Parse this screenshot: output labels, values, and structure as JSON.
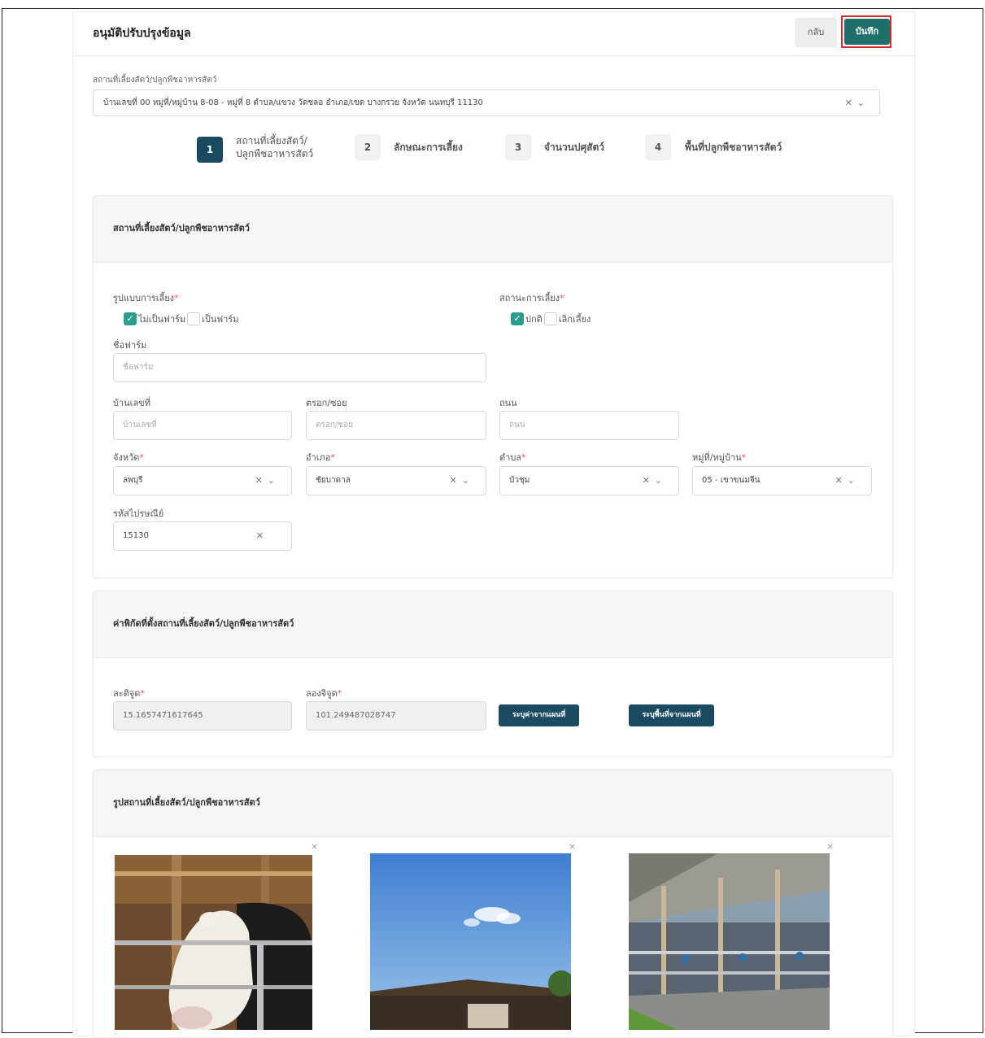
{
  "header": {
    "title": "อนุมัติปรับปรุงข้อมูล",
    "back_label": "กลับ",
    "save_label": "บันทึก"
  },
  "location_select": {
    "label": "สถานที่เลี้ยงสัตว์/ปลูกพืชอาหารสัตว์",
    "value": "บ้านเลขที่ 00 หมู่ที่/หมู่บ้าน 8-08 - หมู่ที่ 8 ตำบล/แขวง วัดชลอ อำเภอ/เขต บางกรวย จังหวัด นนทบุรี 11130"
  },
  "steps": [
    {
      "num": "1",
      "label_l1": "สถานที่เลี้ยงสัตว์/",
      "label_l2": "ปลูกพืชอาหารสัตว์",
      "active": true
    },
    {
      "num": "2",
      "label_l1": "ลักษณะการเลี้ยง",
      "label_l2": "",
      "active": false
    },
    {
      "num": "3",
      "label_l1": "จำนวนปศุสัตว์",
      "label_l2": "",
      "active": false
    },
    {
      "num": "4",
      "label_l1": "พื้นที่ปลูกพืชอาหารสัตว์",
      "label_l2": "",
      "active": false
    }
  ],
  "section1": {
    "title": "สถานที่เลี้ยงสัตว์/ปลูกพืชอาหารสัตว์",
    "farm_type": {
      "label": "รูปแบบการเลี้ยง",
      "opt1": "ไม่เป็นฟาร์ม",
      "opt1_checked": true,
      "opt2": "เป็นฟาร์ม",
      "opt2_checked": false
    },
    "status": {
      "label": "สถานะการเลี้ยง",
      "opt1": "ปกติ",
      "opt1_checked": true,
      "opt2": "เลิกเลี้ยง",
      "opt2_checked": false
    },
    "farm_name": {
      "label": "ชื่อฟาร์ม",
      "placeholder": "ชื่อฟาร์ม"
    },
    "house_no": {
      "label": "บ้านเลขที่",
      "placeholder": "บ้านเลขที่"
    },
    "soi": {
      "label": "ตรอก/ซอย",
      "placeholder": "ตรอก/ซอย"
    },
    "road": {
      "label": "ถนน",
      "placeholder": "ถนน"
    },
    "province": {
      "label": "จังหวัด",
      "value": "ลพบุรี"
    },
    "district": {
      "label": "อำเภอ",
      "value": "ชัยบาดาล"
    },
    "subdistrict": {
      "label": "ตำบล",
      "value": "บัวชุม"
    },
    "village": {
      "label": "หมู่ที่/หมู่บ้าน",
      "value": "05 - เขาขนมจีน"
    },
    "postcode": {
      "label": "รหัสไปรษณีย์",
      "value": "15130"
    }
  },
  "section2": {
    "title": "ค่าพิกัดที่ตั้งสถานที่เลี้ยงสัตว์/ปลูกพืชอาหารสัตว์",
    "lat": {
      "label": "ละติจูด",
      "value": "15.1657471617645"
    },
    "lng": {
      "label": "ลองจิจูด",
      "value": "101.249487028747"
    },
    "btn_pick_point": "ระบุค่าจากแผนที่",
    "btn_pick_area": "ระบุพื้นที่จากแผนที่"
  },
  "section3": {
    "title": "รูปสถานที่เลี้ยงสัตว์/ปลูกพืชอาหารสัตว์",
    "remove_symbol": "×"
  },
  "icons": {
    "clear": "close-icon",
    "dropdown": "chevron-down-icon",
    "check": "check-icon"
  },
  "colors": {
    "primary": "#1b4a63",
    "save": "#1f6f6a",
    "check": "#2a9d8f",
    "highlight": "#d62828",
    "required": "#e05a5a"
  }
}
